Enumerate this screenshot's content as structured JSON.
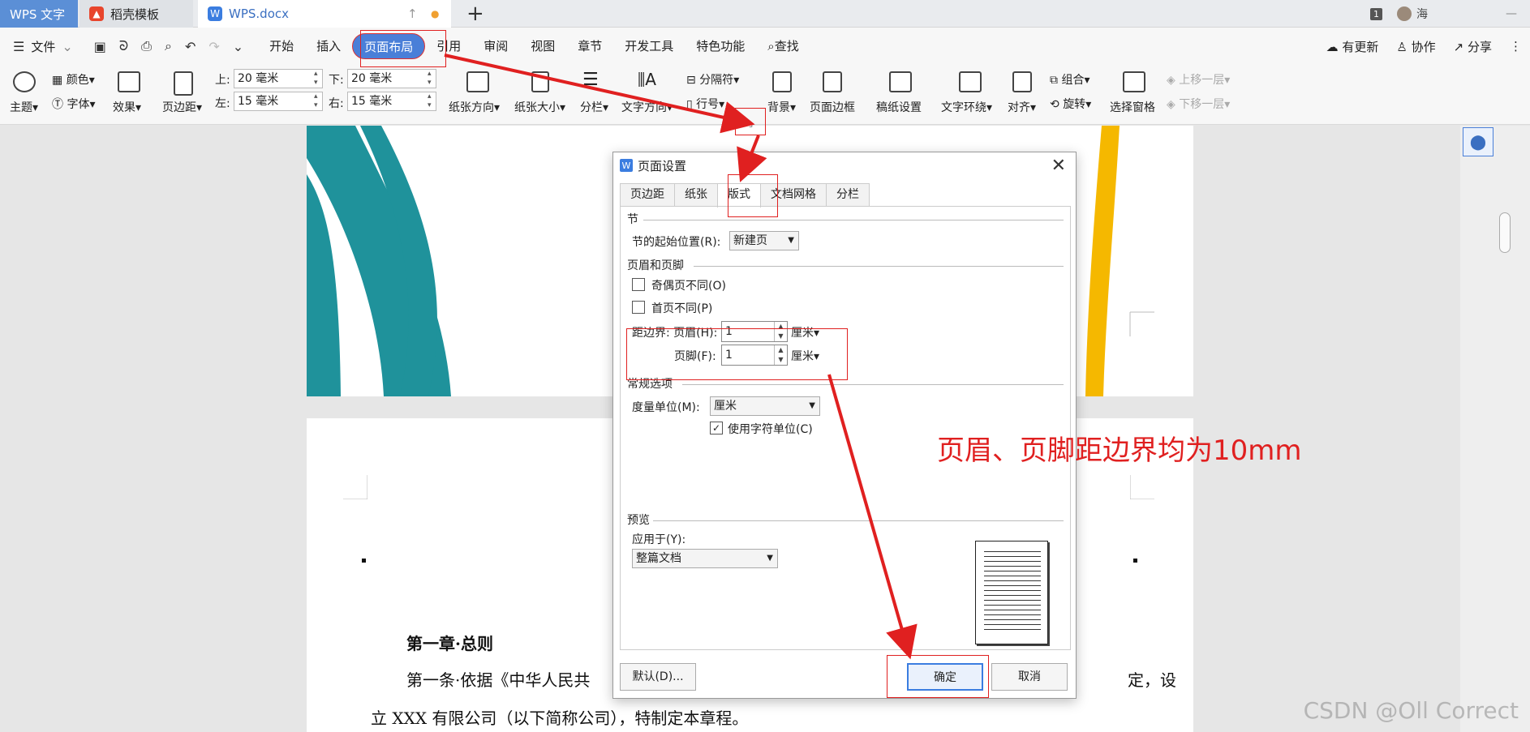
{
  "tabs": {
    "app": "WPS 文字",
    "template": "稻壳模板",
    "doc": "WPS.docx"
  },
  "titlebar": {
    "page_count": "1",
    "user": "海"
  },
  "menu": {
    "file": "文件",
    "items": [
      "开始",
      "插入",
      "页面布局",
      "引用",
      "审阅",
      "视图",
      "章节",
      "开发工具",
      "特色功能"
    ],
    "search": "查找",
    "update": "有更新",
    "collab": "协作",
    "share": "分享"
  },
  "ribbon": {
    "theme": "主题",
    "color": "颜色",
    "font": "字体",
    "effect": "效果",
    "margin": "页边距",
    "top_label": "上:",
    "top_val": "20 毫米",
    "bottom_label": "下:",
    "bottom_val": "20 毫米",
    "left_label": "左:",
    "left_val": "15 毫米",
    "right_label": "右:",
    "right_val": "15 毫米",
    "orientation": "纸张方向",
    "size": "纸张大小",
    "columns": "分栏",
    "textdir": "文字方向",
    "separator": "分隔符",
    "linenum": "行号",
    "background": "背景",
    "border": "页面边框",
    "manuscript": "稿纸设置",
    "wrap": "文字环绕",
    "align": "对齐",
    "group": "组合",
    "rotate": "旋转",
    "pane": "选择窗格",
    "up": "上移一层",
    "down": "下移一层"
  },
  "document": {
    "chapter": "第一章·总则",
    "line1_a": "第一条·依据《中华人民共",
    "line1_b": "定，设",
    "line2": "立 XXX 有限公司（以下简称公司），特制定本章程。"
  },
  "dialog": {
    "title": "页面设置",
    "tabs": [
      "页边距",
      "纸张",
      "版式",
      "文档网格",
      "分栏"
    ],
    "section_heading": "节",
    "section_start_label": "节的起始位置(R):",
    "section_start_value": "新建页",
    "hf_heading": "页眉和页脚",
    "odd_even": "奇偶页不同(O)",
    "first_page": "首页不同(P)",
    "header_label": "距边界: 页眉(H):",
    "header_value": "1",
    "footer_label": "页脚(F):",
    "footer_value": "1",
    "unit_cm": "厘米",
    "general_heading": "常规选项",
    "measure_label": "度量单位(M):",
    "measure_value": "厘米",
    "char_unit": "使用字符单位(C)",
    "preview_heading": "预览",
    "apply_label": "应用于(Y):",
    "apply_value": "整篇文档",
    "default_btn": "默认(D)...",
    "ok_btn": "确定",
    "cancel_btn": "取消"
  },
  "annotation": "页眉、页脚距边界均为10mm",
  "watermark": "CSDN @Oll Correct",
  "colors": {
    "accent": "#4a7fd8",
    "annotation": "#e02020",
    "teal": "#1f929b",
    "yellow": "#f5b800"
  }
}
